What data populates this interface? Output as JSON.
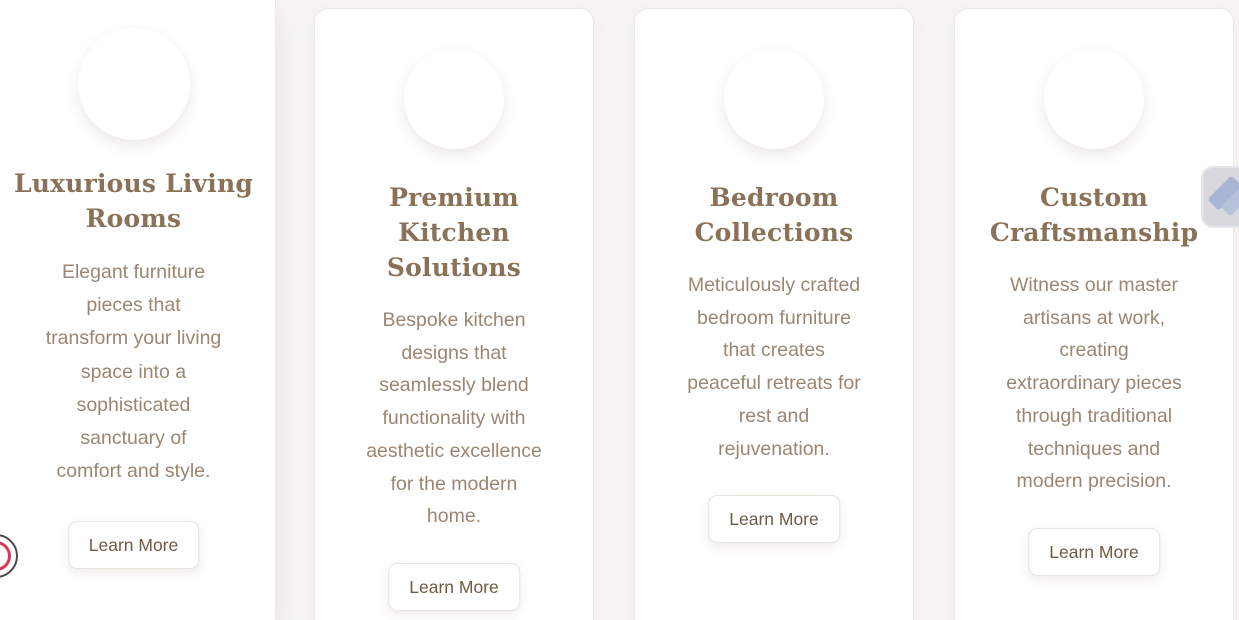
{
  "cards": [
    {
      "title_lines": [
        "Luxurious Living",
        "Rooms"
      ],
      "description_lines": [
        "Elegant furniture",
        "pieces that",
        "transform your living",
        "space into a",
        "sophisticated",
        "sanctuary of",
        "comfort and style."
      ],
      "button_label": "Learn More"
    },
    {
      "title_lines": [
        "Premium",
        "Kitchen",
        "Solutions"
      ],
      "description_lines": [
        "Bespoke kitchen",
        "designs that",
        "seamlessly blend",
        "functionality with",
        "aesthetic excellence",
        "for the modern",
        "home."
      ],
      "button_label": "Learn More"
    },
    {
      "title_lines": [
        "Bedroom",
        "Collections"
      ],
      "description_lines": [
        "Meticulously crafted",
        "bedroom furniture",
        "that creates",
        "peaceful retreats for",
        "rest and",
        "rejuvenation."
      ],
      "button_label": "Learn More"
    },
    {
      "title_lines": [
        "Custom",
        "Craftsmanship"
      ],
      "description_lines": [
        "Witness our master",
        "artisans at work,",
        "creating",
        "extraordinary pieces",
        "through traditional",
        "techniques and",
        "modern precision."
      ],
      "button_label": "Learn More"
    }
  ],
  "icons": {
    "side_widget": "pencil-icon",
    "accessibility_badge": "accessibility-icon"
  },
  "colors": {
    "title": "#8a7259",
    "description": "#9a8672",
    "button_text": "#6f5a46",
    "background": "#f6f5f3"
  }
}
